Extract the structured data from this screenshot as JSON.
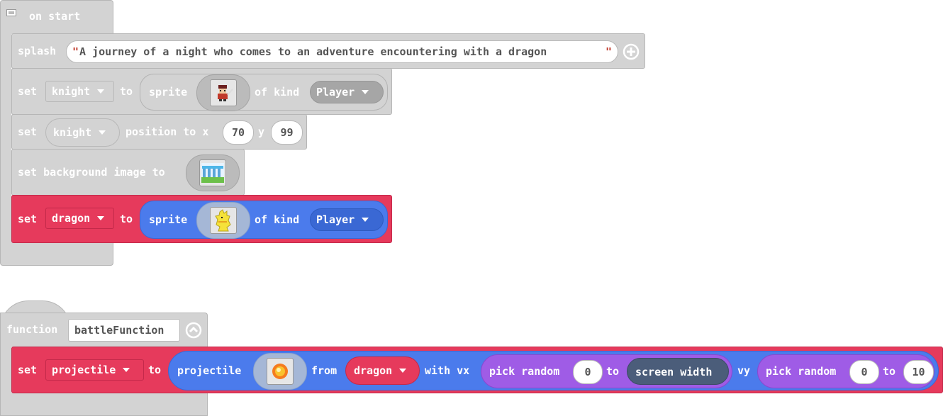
{
  "on_start": {
    "title": "on start",
    "splash": {
      "label": "splash",
      "text_quote_open": "\"",
      "text": "A journey of a night who comes to an adventure encountering with a dragon ",
      "text_quote_close": "\""
    },
    "set_knight": {
      "set_label": "set",
      "variable": "knight",
      "to_label": "to",
      "sprite_label": "sprite",
      "of_kind_label": "of kind",
      "kind": "Player",
      "sprite_icon": "knight-sprite-icon"
    },
    "set_position": {
      "set_label": "set",
      "variable": "knight",
      "position_label": "position to x",
      "x": "70",
      "y_label": "y",
      "y": "99"
    },
    "set_background": {
      "label": "set background image to",
      "image_icon": "background-image-icon"
    },
    "set_dragon": {
      "set_label": "set",
      "variable": "dragon",
      "to_label": "to",
      "sprite_label": "sprite",
      "of_kind_label": "of kind",
      "kind": "Player",
      "sprite_icon": "dragon-sprite-icon"
    }
  },
  "function_block": {
    "function_label": "function",
    "name": "battleFunction",
    "set_projectile": {
      "set_label": "set",
      "variable": "projectile",
      "to_label": "to",
      "projectile_label": "projectile",
      "from_label": "from",
      "from_variable": "dragon",
      "with_vx_label": "with vx",
      "vx": {
        "label": "pick random",
        "from": "0",
        "to_label": "to",
        "to": "screen width"
      },
      "vy_label": "vy",
      "vy": {
        "label": "pick random",
        "from": "0",
        "to_label": "to",
        "to": "10"
      },
      "projectile_icon": "fireball-icon"
    }
  },
  "colors": {
    "grey_block": "#d3d3d3",
    "sprites_red": "#e63a5c",
    "sprites_blue": "#4b7bec",
    "math_purple": "#9f5ce6",
    "scene_dark": "#4b5d7a"
  }
}
